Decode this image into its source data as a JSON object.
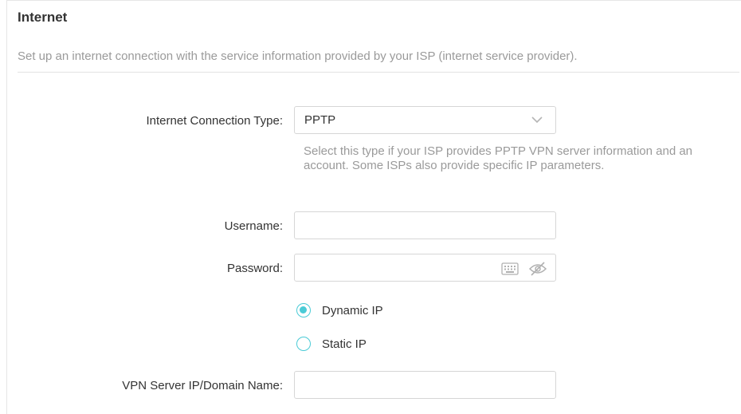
{
  "section": {
    "title": "Internet",
    "description": "Set up an internet connection with the service information provided by your ISP (internet service provider)."
  },
  "connection_type": {
    "label": "Internet Connection Type:",
    "value": "PPTP",
    "hint": "Select this type if your ISP provides PPTP VPN server information and an account. Some ISPs also provide specific IP parameters."
  },
  "username": {
    "label": "Username:",
    "value": ""
  },
  "password": {
    "label": "Password:",
    "value": "",
    "icons": [
      "keyboard-icon",
      "hide-password-icon"
    ]
  },
  "ip_mode": {
    "options": [
      {
        "label": "Dynamic IP",
        "selected": true
      },
      {
        "label": "Static IP",
        "selected": false
      }
    ]
  },
  "vpn_server": {
    "label": "VPN Server IP/Domain Name:",
    "value": ""
  },
  "colors": {
    "accent": "#4acbd6",
    "text": "#333333",
    "muted": "#9a9a9a",
    "border": "#d6d6d6"
  }
}
